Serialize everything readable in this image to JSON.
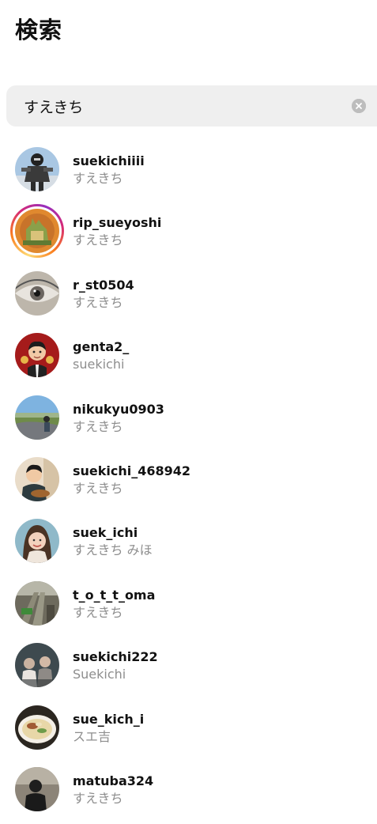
{
  "header": {
    "title": "検索"
  },
  "search": {
    "value": "すえきち",
    "clear_icon": "clear-circle-icon"
  },
  "results": [
    {
      "username": "suekichiiii",
      "name": "すえきち",
      "has_story": false
    },
    {
      "username": "rip_sueyoshi",
      "name": "すえきち",
      "has_story": true
    },
    {
      "username": "r_st0504",
      "name": "すえきち",
      "has_story": false
    },
    {
      "username": "genta2_",
      "name": "suekichi",
      "has_story": false
    },
    {
      "username": "nikukyu0903",
      "name": "すえきち",
      "has_story": false
    },
    {
      "username": "suekichi_468942",
      "name": "すえきち",
      "has_story": false
    },
    {
      "username": "suek_ichi",
      "name": "すえきち みほ",
      "has_story": false
    },
    {
      "username": "t_o_t_t_oma",
      "name": "すえきち",
      "has_story": false
    },
    {
      "username": "suekichi222",
      "name": "Suekichi",
      "has_story": false
    },
    {
      "username": "sue_kich_i",
      "name": "スエ吉",
      "has_story": false
    },
    {
      "username": "matuba324",
      "name": "すえきち",
      "has_story": false
    }
  ],
  "colors": {
    "search_bg": "#efefef",
    "secondary_text": "#8e8e8e",
    "primary_text": "#111111",
    "story_ring": [
      "#feda75",
      "#fa7e1e",
      "#d62976",
      "#962fbf"
    ]
  }
}
